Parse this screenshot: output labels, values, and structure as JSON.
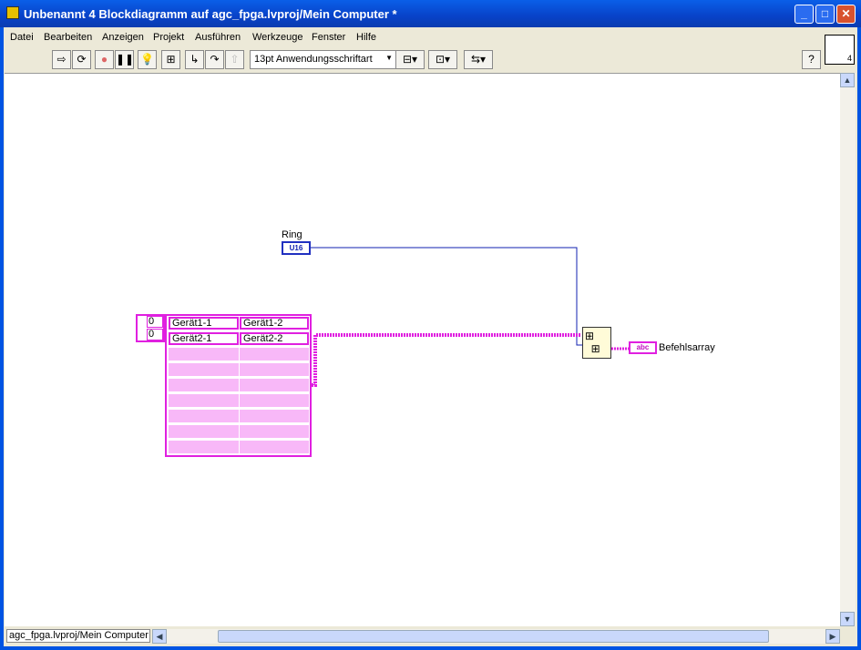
{
  "window": {
    "title": "Unbenannt 4 Blockdiagramm auf agc_fpga.lvproj/Mein Computer *"
  },
  "menu": [
    "Datei",
    "Bearbeiten",
    "Anzeigen",
    "Projekt",
    "Ausführen",
    "Werkzeuge",
    "Fenster",
    "Hilfe"
  ],
  "toolbar": {
    "font": "13pt Anwendungsschriftart",
    "help": "?"
  },
  "vi_icon": {
    "number": "4"
  },
  "diagram": {
    "ring": {
      "label": "Ring",
      "type": "U16"
    },
    "array_index": [
      "0",
      "0"
    ],
    "table": [
      [
        "Gerät1-1",
        "Gerät1-2"
      ],
      [
        "Gerät2-1",
        "Gerät2-2"
      ]
    ],
    "indicator": {
      "label": "Befehlsarray",
      "type": "abc"
    }
  },
  "status": {
    "context": "agc_fpga.lvproj/Mein Computer"
  },
  "colors": {
    "string_wire": "#e020e0",
    "u16_wire": "#1020b0"
  }
}
